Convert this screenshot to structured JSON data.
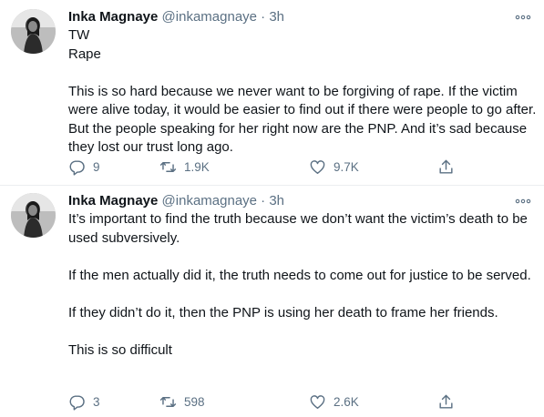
{
  "tweets": [
    {
      "name": "Inka Magnaye",
      "handle": "@inkamagnaye",
      "separator": "·",
      "time": "3h",
      "lines": [
        "TW",
        "Rape",
        "",
        "This is so hard because we never want to be forgiving of rape. If the victim were alive today, it would be easier to find out if there were people to go after. But the people speaking for her right now are the PNP. And it’s sad because they lost our trust long ago."
      ],
      "replies": "9",
      "retweets": "1.9K",
      "likes": "9.7K"
    },
    {
      "name": "Inka Magnaye",
      "handle": "@inkamagnaye",
      "separator": "·",
      "time": "3h",
      "lines": [
        "It’s important to find the truth because we don’t want the victim’s death to be used subversively.",
        "",
        "If the men actually did it, the truth needs to come out for justice to be served.",
        "",
        "If they didn’t do it, then the PNP is using her death to frame her friends.",
        "",
        "This is so difficult"
      ],
      "replies": "3",
      "retweets": "598",
      "likes": "2.6K"
    }
  ],
  "icons": {
    "reply": "reply-icon",
    "retweet": "retweet-icon",
    "like": "heart-icon",
    "share": "share-icon",
    "more": "more-icon"
  },
  "colors": {
    "text": "#0f1419",
    "secondary": "#5b7083",
    "divider": "#ebeef0"
  }
}
